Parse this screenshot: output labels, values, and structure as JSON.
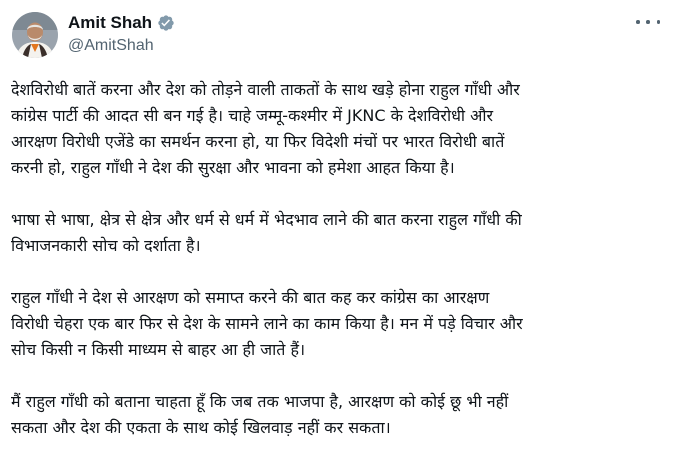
{
  "author": {
    "display_name": "Amit Shah",
    "handle": "@AmitShah",
    "avatar_icon": "avatar-photo",
    "verified_icon": "verified-badge-icon",
    "verified_color": "#829aab"
  },
  "menu_icon": "more-options-icon",
  "paragraphs": [
    {
      "lines": [
        "देशविरोधी बातें करना और देश को तोड़ने वाली ताकतों के साथ खड़े होना राहुल गाँधी और",
        "कांग्रेस पार्टी की आदत सी बन गई है। चाहे जम्मू-कश्मीर में JKNC के देशविरोधी और",
        "आरक्षण विरोधी एजेंडे का समर्थन करना हो, या फिर विदेशी मंचों पर भारत विरोधी बातें",
        "करनी हो, राहुल गाँधी ने देश की सुरक्षा और भावना को हमेशा आहत किया है।"
      ]
    },
    {
      "lines": [
        "भाषा से भाषा, क्षेत्र से क्षेत्र और धर्म से धर्म में भेदभाव लाने की बात करना राहुल गाँधी की",
        "विभाजनकारी सोच को दर्शाता है।"
      ]
    },
    {
      "lines": [
        "राहुल गाँधी ने देश से आरक्षण को समाप्त करने की बात कह कर कांग्रेस का आरक्षण",
        "विरोधी चेहरा एक बार फिर से देश के सामने लाने का काम किया है। मन में पड़े विचार और",
        "सोच किसी न किसी माध्यम से बाहर आ ही जाते हैं।"
      ]
    },
    {
      "lines": [
        "मैं राहुल गाँधी को बताना चाहता हूँ कि जब तक भाजपा है, आरक्षण को कोई छू भी नहीं",
        "सकता और देश की एकता के साथ कोई खिलवाड़ नहीं कर सकता।"
      ]
    }
  ]
}
